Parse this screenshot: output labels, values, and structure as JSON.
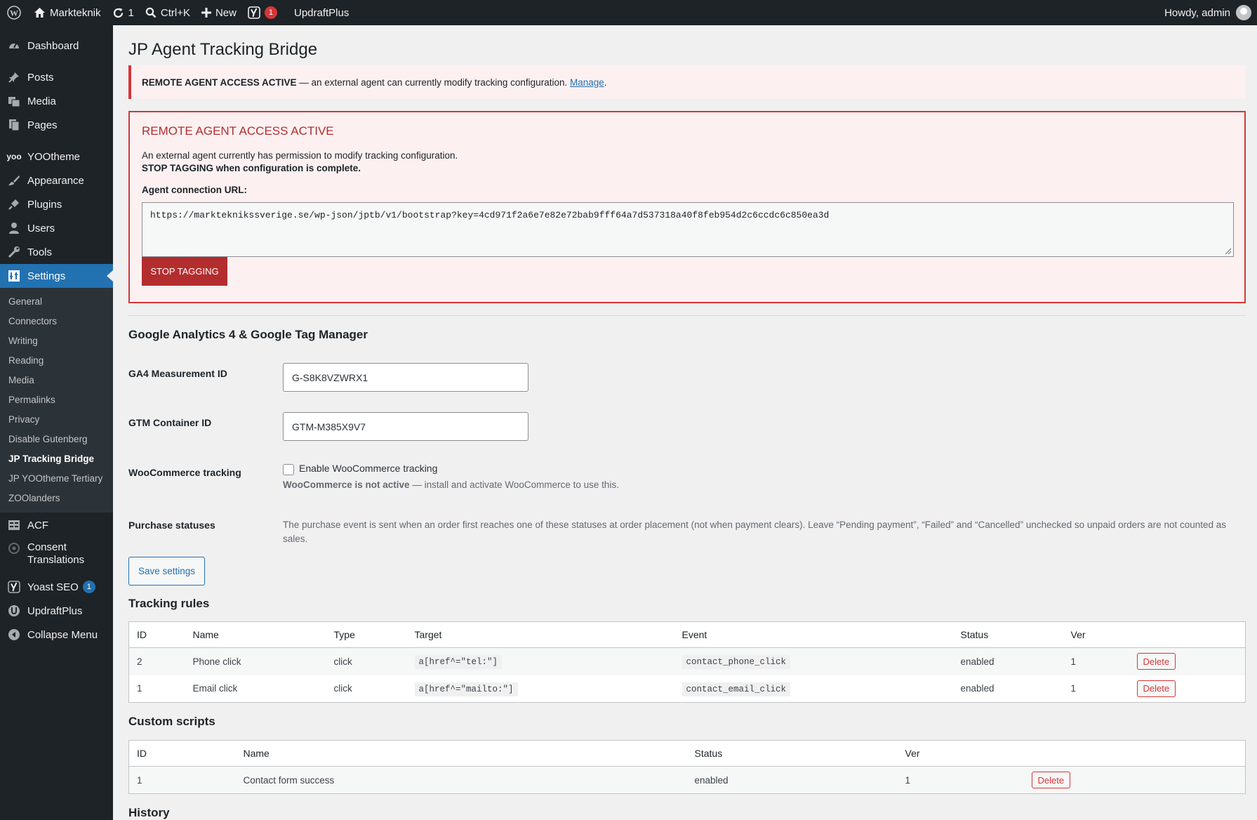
{
  "adminbar": {
    "site_name": "Markteknik",
    "updates_count": "1",
    "search_shortcut": "Ctrl+K",
    "new_label": "New",
    "yoast_count": "1",
    "updraft_label": "UpdraftPlus",
    "howdy": "Howdy, admin"
  },
  "sidebar": {
    "items": [
      {
        "label": "Dashboard",
        "icon": "dashboard-icon"
      },
      {
        "label": "Posts",
        "icon": "pin-icon"
      },
      {
        "label": "Media",
        "icon": "media-icon"
      },
      {
        "label": "Pages",
        "icon": "pages-icon"
      },
      {
        "label": "YOOtheme",
        "icon": "yootheme-icon"
      },
      {
        "label": "Appearance",
        "icon": "brush-icon"
      },
      {
        "label": "Plugins",
        "icon": "plug-icon"
      },
      {
        "label": "Users",
        "icon": "user-icon"
      },
      {
        "label": "Tools",
        "icon": "wrench-icon"
      },
      {
        "label": "Settings",
        "icon": "settings-icon"
      }
    ],
    "submenu": [
      "General",
      "Connectors",
      "Writing",
      "Reading",
      "Media",
      "Permalinks",
      "Privacy",
      "Disable Gutenberg",
      "JP Tracking Bridge",
      "JP YOOtheme Tertiary",
      "ZOOlanders"
    ],
    "acf": "ACF",
    "consent_line1": "Consent",
    "consent_line2": "Translations",
    "yoast": "Yoast SEO",
    "yoast_count": "1",
    "updraft": "UpdraftPlus",
    "collapse": "Collapse Menu"
  },
  "page": {
    "title": "JP Agent Tracking Bridge",
    "notice_bold": "REMOTE AGENT ACCESS ACTIVE",
    "notice_text": " — an external agent can currently modify tracking configuration. ",
    "notice_link": "Manage",
    "notice_end": ".",
    "alert_title": "REMOTE AGENT ACCESS ACTIVE",
    "alert_p1": "An external agent currently has permission to modify tracking configuration.",
    "alert_p2": "STOP TAGGING when configuration is complete.",
    "alert_url_label": "Agent connection URL:",
    "alert_url": "https://markteknikssverige.se/wp-json/jptb/v1/bootstrap?key=4cd971f2a6e7e82e72bab9fff64a7d537318a40f8feb954d2c6ccdc6c850ea3d",
    "stop_button": "STOP TAGGING"
  },
  "ga_section": {
    "title": "Google Analytics 4 & Google Tag Manager",
    "ga4_label": "GA4 Measurement ID",
    "ga4_value": "G-S8K8VZWRX1",
    "gtm_label": "GTM Container ID",
    "gtm_value": "GTM-M385X9V7",
    "woo_label": "WooCommerce tracking",
    "woo_checkbox_label": "Enable WooCommerce tracking",
    "woo_note_bold": "WooCommerce is not active",
    "woo_note_rest": " — install and activate WooCommerce to use this.",
    "purchase_label": "Purchase statuses",
    "purchase_text": "The purchase event is sent when an order first reaches one of these statuses at order placement (not when payment clears). Leave “Pending payment”, “Failed” and “Cancelled” unchecked so unpaid orders are not counted as sales.",
    "save_button": "Save settings"
  },
  "tracking_rules": {
    "title": "Tracking rules",
    "headers": [
      "ID",
      "Name",
      "Type",
      "Target",
      "Event",
      "Status",
      "Ver"
    ],
    "rows": [
      {
        "id": "2",
        "name": "Phone click",
        "type": "click",
        "target": "a[href^=\"tel:\"]",
        "event": "contact_phone_click",
        "status": "enabled",
        "ver": "1",
        "delete": "Delete"
      },
      {
        "id": "1",
        "name": "Email click",
        "type": "click",
        "target": "a[href^=\"mailto:\"]",
        "event": "contact_email_click",
        "status": "enabled",
        "ver": "1",
        "delete": "Delete"
      }
    ]
  },
  "custom_scripts": {
    "title": "Custom scripts",
    "headers": [
      "ID",
      "Name",
      "Status",
      "Ver"
    ],
    "rows": [
      {
        "id": "1",
        "name": "Contact form success",
        "status": "enabled",
        "ver": "1",
        "delete": "Delete"
      }
    ]
  },
  "history": {
    "title": "History"
  }
}
